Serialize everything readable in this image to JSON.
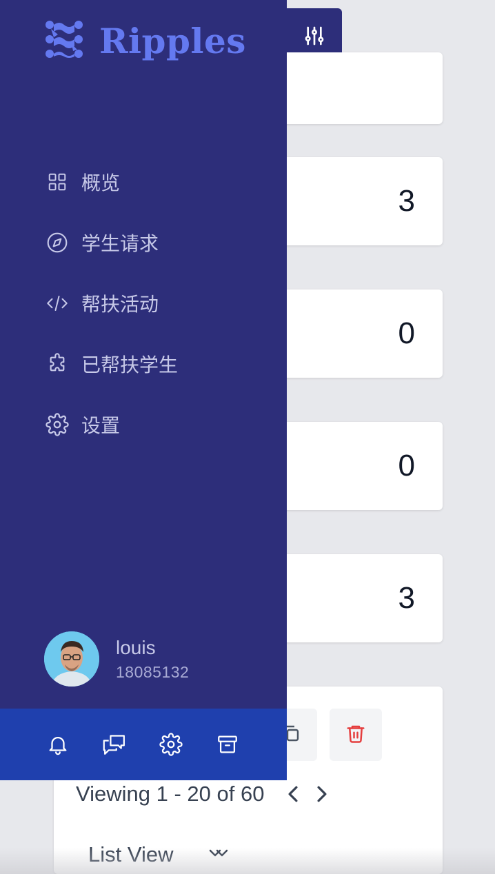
{
  "sidebar": {
    "brand": "Ripples",
    "nav": [
      {
        "label": "概览",
        "icon": "grid-icon"
      },
      {
        "label": "学生请求",
        "icon": "compass-icon"
      },
      {
        "label": "帮扶活动",
        "icon": "code-icon"
      },
      {
        "label": "已帮扶学生",
        "icon": "puzzle-icon"
      },
      {
        "label": "设置",
        "icon": "gear-icon"
      }
    ],
    "user": {
      "name": "louis",
      "id": "18085132"
    },
    "footer_icons": [
      "bell-icon",
      "chat-icon",
      "gear-icon",
      "archive-icon"
    ]
  },
  "main": {
    "stats": [
      "",
      "3",
      "0",
      "0",
      "3"
    ],
    "pagination": {
      "text": "Viewing 1 - 20 of 60"
    },
    "view_mode": "List View"
  },
  "colors": {
    "sidebar_bg": "#2d2e7a",
    "footer_bg": "#1f40ae",
    "brand": "#6479f0",
    "danger": "#e53e3e"
  }
}
